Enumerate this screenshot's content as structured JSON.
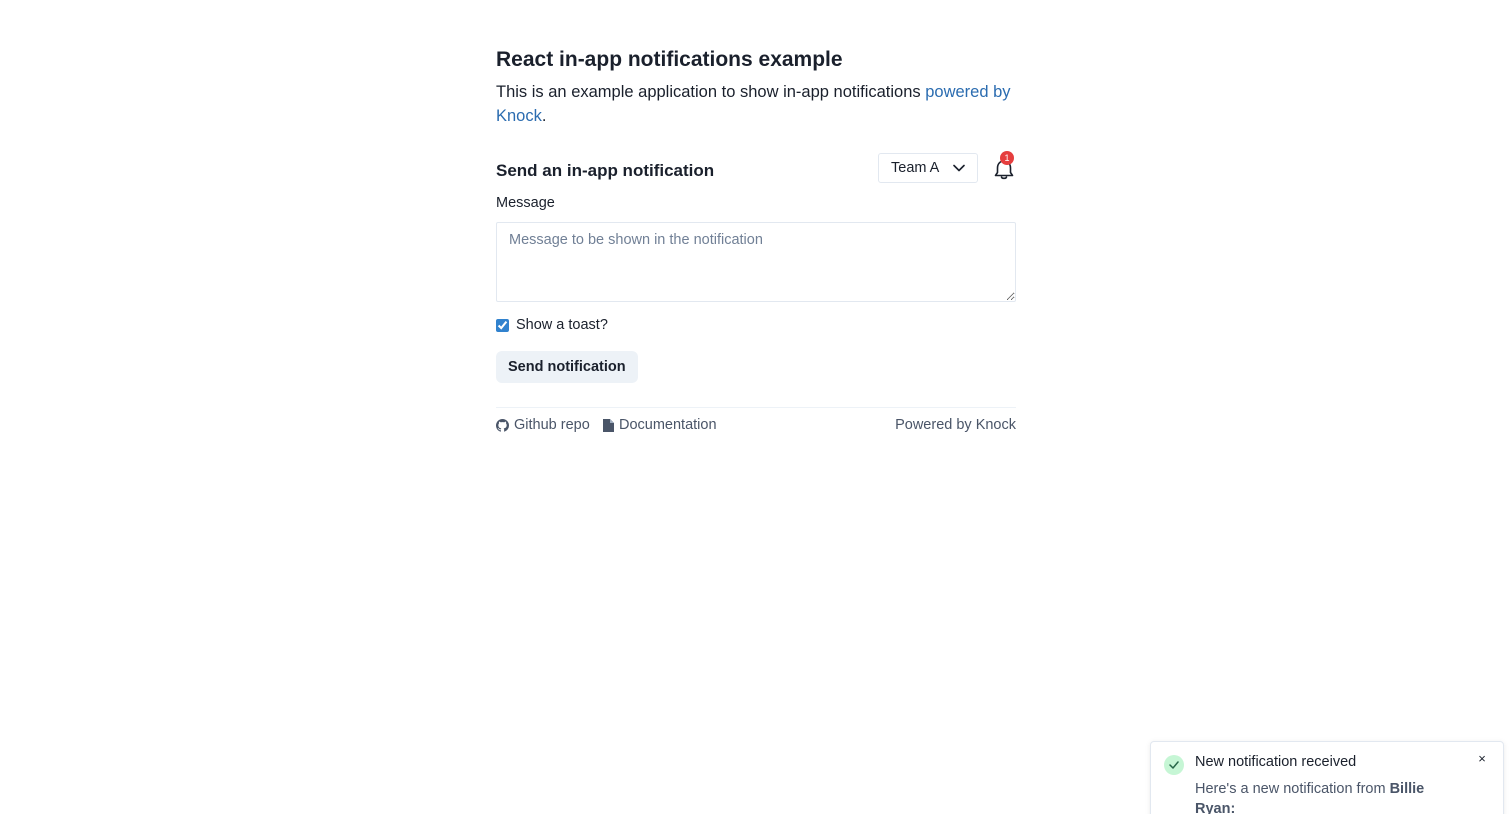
{
  "header": {
    "title": "React in-app notifications example",
    "intro_text": "This is an example application to show in-app notifications ",
    "intro_link": "powered by Knock",
    "intro_end": "."
  },
  "send_section": {
    "title": "Send an in-app notification",
    "team_select": {
      "selected": "Team A",
      "icon": "chevron-down-icon"
    },
    "bell": {
      "icon": "bell-icon",
      "badge_count": "1",
      "badge_color": "#e53e3e"
    },
    "message_label": "Message",
    "message_placeholder": "Message to be shown in the notification",
    "message_value": "",
    "toast_checkbox_label": "Show a toast?",
    "toast_checkbox_checked": true,
    "send_button_label": "Send notification"
  },
  "footer": {
    "github_icon": "github-icon",
    "github_label": "Github repo",
    "docs_icon": "document-icon",
    "docs_label": "Documentation",
    "powered_label": "Powered by Knock"
  },
  "toast": {
    "icon": "check-icon",
    "title": "New notification received",
    "body_prefix": "Here's a new notification from ",
    "body_sender": "Billie Ryan",
    "body_suffix": ":",
    "close_label": "×"
  },
  "colors": {
    "link": "#2b6cb0",
    "checkbox": "#3182ce",
    "button_bg": "#edf2f7",
    "toast_check_bg": "#c6f6d5"
  }
}
